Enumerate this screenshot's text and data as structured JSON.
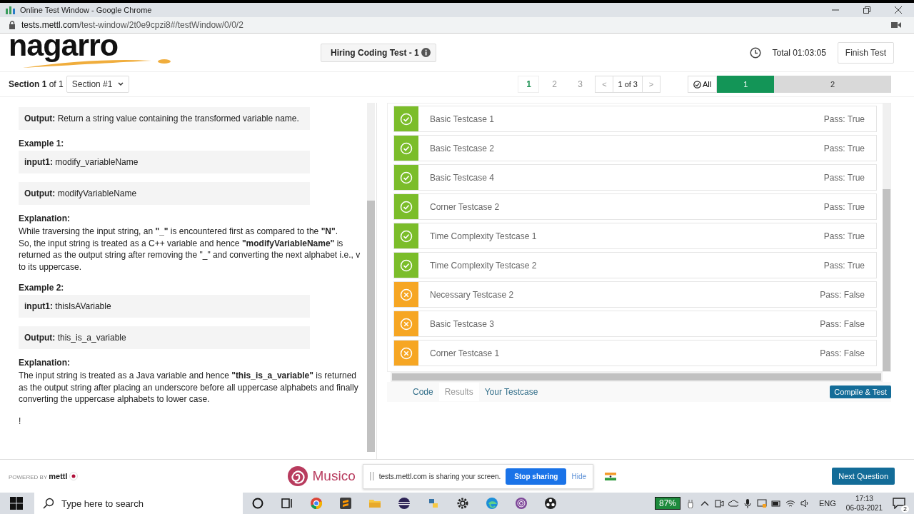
{
  "window": {
    "title": "Online Test Window - Google Chrome",
    "url_host": "tests.mettl.com",
    "url_path": "/test-window/2t0e9cpzi8#/testWindow/0/0/2"
  },
  "header": {
    "logo": "nagarro",
    "test_title": "Hiring Coding Test - 1",
    "timer": "Total 01:03:05",
    "finish_button": "Finish Test"
  },
  "section_bar": {
    "label": "**Section 1** of 1",
    "dropdown": "Section #1",
    "pages": [
      {
        "label": "1",
        "selected": true
      },
      {
        "label": "2",
        "selected": false
      },
      {
        "label": "3",
        "selected": false
      }
    ],
    "prev": "<",
    "page_of": "1 of 3",
    "next": ">",
    "filter": "All",
    "questions": [
      {
        "label": "1",
        "selected": true
      },
      {
        "label": "2",
        "selected": false
      }
    ]
  },
  "problem": [
    {
      "kind": "box",
      "text": "**Output:** Return a string value containing the transformed variable name."
    },
    {
      "kind": "heading",
      "text": "Example 1:"
    },
    {
      "kind": "box",
      "text": "**input1:** modify_variableName"
    },
    {
      "kind": "box",
      "text": "**Output:** modifyVariableName"
    },
    {
      "kind": "heading",
      "text": "Explanation:"
    },
    {
      "kind": "para",
      "text": "While traversing the input string, an **\"_\"** is encountered first as compared to the **\"N\"**.\nSo, the input string is treated as a C++ variable and hence **\"modifyVariableName\"** is returned as the output string after removing the \"_\" and converting the next alphabet i.e., v to its uppercase."
    },
    {
      "kind": "heading",
      "text": "Example 2:"
    },
    {
      "kind": "box",
      "text": "**input1:** thisIsAVariable"
    },
    {
      "kind": "box",
      "text": "**Output:** this_is_a_variable"
    },
    {
      "kind": "heading",
      "text": "Explanation:"
    },
    {
      "kind": "para",
      "text": "The input string is treated as a Java variable and hence **\"this_is_a_variable\"** is returned as the output string after placing an underscore before all uppercase alphabets and finally converting the uppercase alphabets to lower case."
    },
    {
      "kind": "para",
      "text": "!"
    }
  ],
  "results": [
    {
      "name": "Basic Testcase 1",
      "passed": true,
      "status": "Pass: True"
    },
    {
      "name": "Basic Testcase 2",
      "passed": true,
      "status": "Pass: True"
    },
    {
      "name": "Basic Testcase 4",
      "passed": true,
      "status": "Pass: True"
    },
    {
      "name": "Corner Testcase 2",
      "passed": true,
      "status": "Pass: True"
    },
    {
      "name": "Time Complexity Testcase 1",
      "passed": true,
      "status": "Pass: True"
    },
    {
      "name": "Time Complexity Testcase 2",
      "passed": true,
      "status": "Pass: True"
    },
    {
      "name": "Necessary Testcase 2",
      "passed": false,
      "status": "Pass: False"
    },
    {
      "name": "Basic Testcase 3",
      "passed": false,
      "status": "Pass: False"
    },
    {
      "name": "Corner Testcase 1",
      "passed": false,
      "status": "Pass: False"
    }
  ],
  "bottom_tabs": [
    {
      "label": "Code",
      "selected": false
    },
    {
      "label": "Results",
      "selected": true
    },
    {
      "label": "Your Testcase",
      "selected": false
    }
  ],
  "compile_button": "Compile & Test",
  "footer": {
    "powered_by": "POWERED BY",
    "brand": "mettl",
    "musico": "Musico",
    "share_message": "tests.mettl.com is sharing your screen.",
    "stop_button": "Stop sharing",
    "hide_link": "Hide",
    "next_button": "Next Question"
  },
  "taskbar": {
    "search_placeholder": "Type here to search",
    "battery": "87%",
    "language": "ENG",
    "time": "17:13",
    "date": "06-03-2021",
    "notifications": "2"
  }
}
